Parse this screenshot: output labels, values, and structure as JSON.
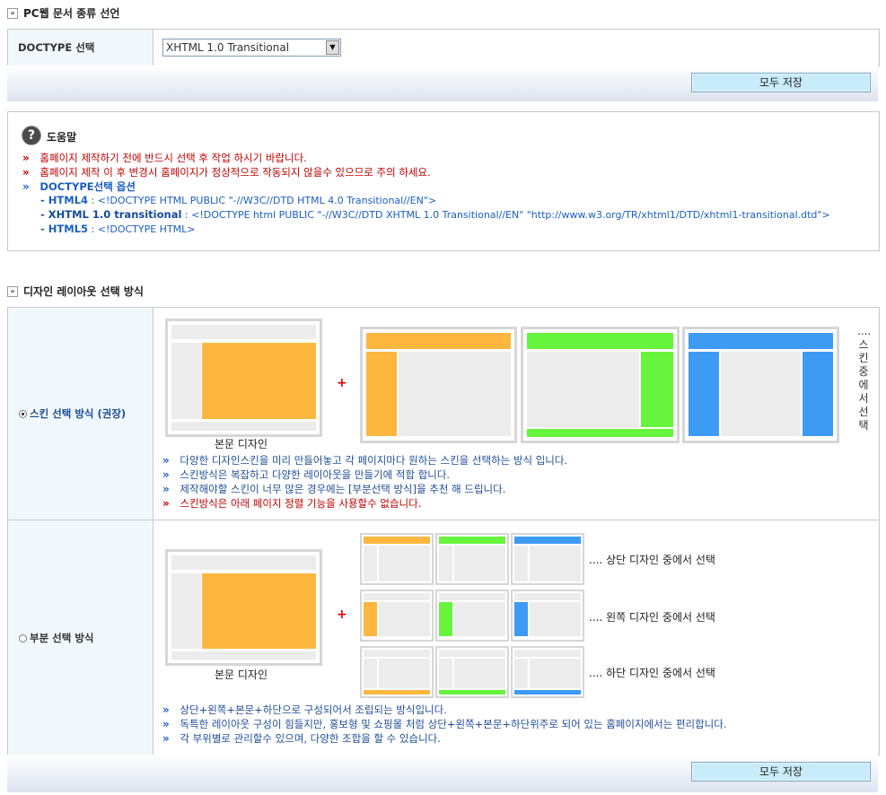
{
  "section1": {
    "title": "PC웹 문서 종류 선언",
    "row_label": "DOCTYPE 선택",
    "select_value": "XHTML 1.0 Transitional",
    "save_label": "모두 저장"
  },
  "help": {
    "title": "도움말",
    "line1": "홈페이지 제작하기 전에 반드시 선택 후 작업 하시기 바랍니다.",
    "line2": "홈페이지 제작 이 후 변경시 홈페이지가 정상적으로 작동되지 않을수 있으므로 주의 하세요.",
    "options_title": "DOCTYPE선택 옵션",
    "opt1_name": "- HTML4",
    "opt1_value": " : <!DOCTYPE HTML PUBLIC \"-//W3C//DTD HTML 4.0 Transitional//EN\">",
    "opt2_name": "- XHTML 1.0 transitional",
    "opt2_value": " : <!DOCTYPE html PUBLIC \"-//W3C//DTD XHTML 1.0 Transitional//EN\" \"http://www.w3.org/TR/xhtml1/DTD/xhtml1-transitional.dtd\">",
    "opt3_name": "- HTML5",
    "opt3_value": " : <!DOCTYPE HTML>"
  },
  "section2": {
    "title": "디자인 레이아웃 선택 방식",
    "skin": {
      "option_label": "스킨 선택 방식 (권장)",
      "selected": true,
      "body_design_label": "본문 디자인",
      "plus": "+",
      "side_text": "....스킨중에서선택",
      "desc1": "다양한 디자인스킨을 미리 만들어놓고 각 페이지마다 원하는 스킨을 선택하는 방식 입니다.",
      "desc2": "스킨방식은 복잡하고 다양한 레이아웃을 만들기에 적합 합니다.",
      "desc3": "제작해야할 스킨이 너무 많은 경우에는 [부분선택 방식]을 추천 해 드립니다.",
      "desc4": "스킨방식은 아래 페이지 정렬 기능을 사용할수 없습니다."
    },
    "partial": {
      "option_label": "부분 선택 방식",
      "selected": false,
      "body_design_label": "본문 디자인",
      "plus": "+",
      "top_label": ".... 상단 디자인 중에서 선택",
      "left_label": ".... 왼쪽 디자인 중에서 선택",
      "bottom_label": ".... 하단 디자인 중에서 선택",
      "desc1": "상단+왼쪽+본문+하단으로 구성되어서 조립되는 방식입니다.",
      "desc2": "독특한 레이아웃 구성이 힘들지만, 홍보형 및 쇼핑몰 처럼 상단+왼쪽+본문+하단위주로 되어 있는 홈페이지에서는 편리합니다.",
      "desc3": "각 부위별로 관리할수 있으며, 다양한 조합을 할 수 있습니다."
    },
    "save_label": "모두 저장"
  },
  "colors": {
    "orange": "#fdb73e",
    "green": "#66f43c",
    "blue": "#3d9bf4"
  },
  "icons": {
    "help": "question-circle-icon",
    "bullet": "double-chevron-icon"
  }
}
